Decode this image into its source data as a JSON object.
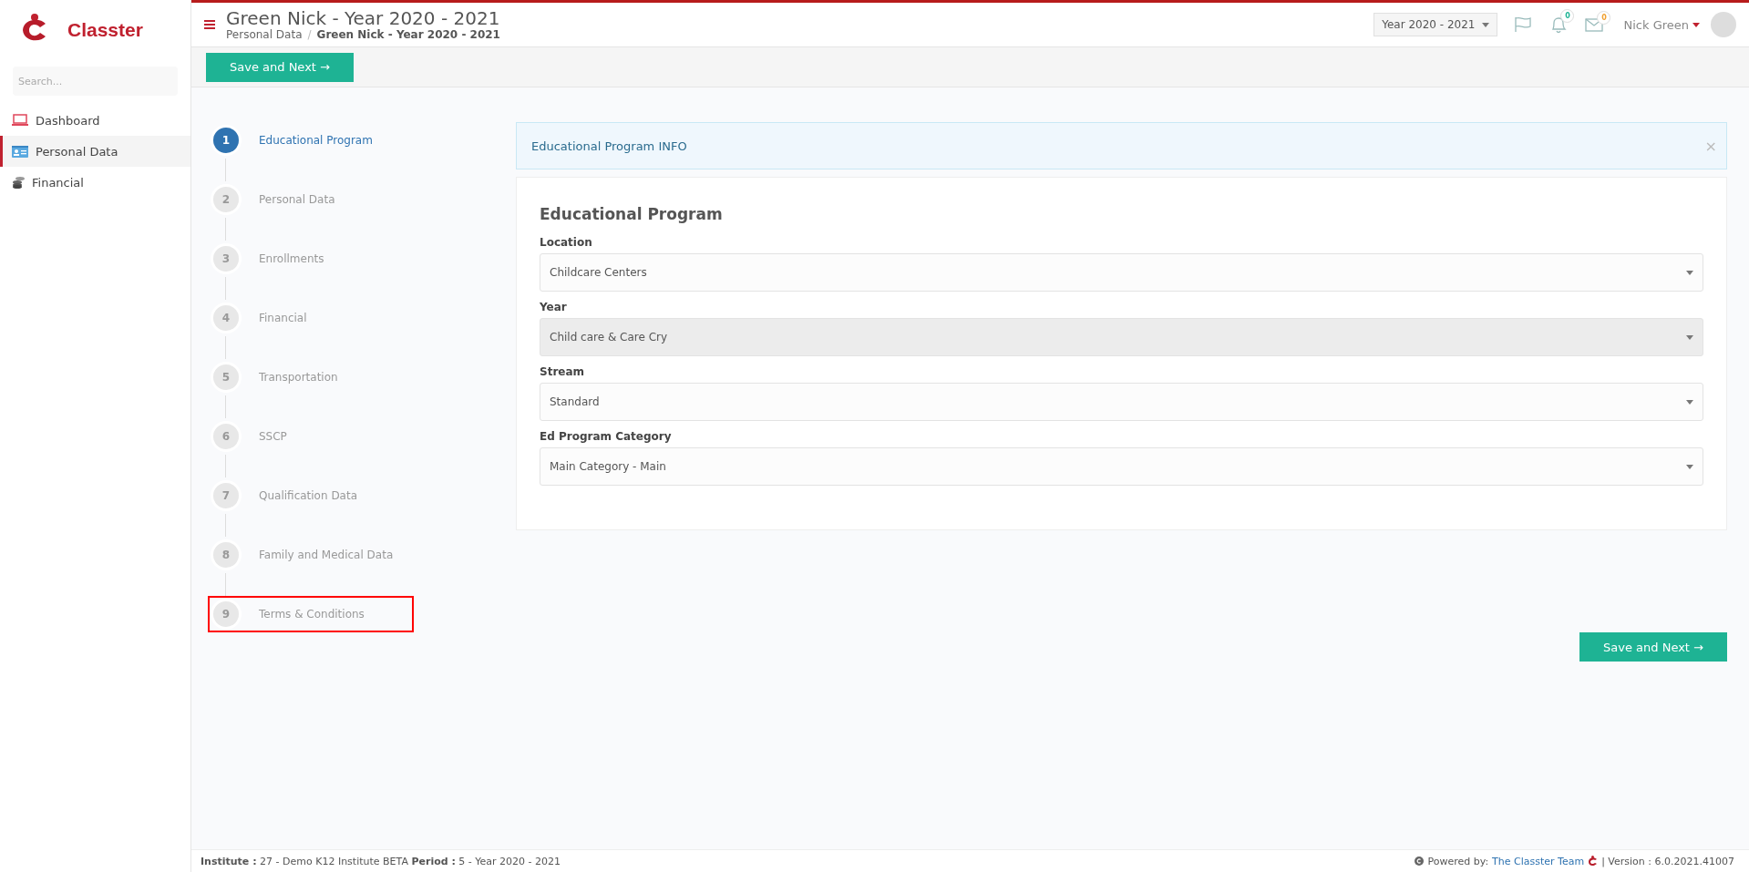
{
  "brand": {
    "name": "Classter"
  },
  "sidebar": {
    "search": {
      "placeholder": "Search..."
    },
    "items": [
      {
        "label": "Dashboard",
        "selected": false
      },
      {
        "label": "Personal Data",
        "selected": true
      },
      {
        "label": "Financial",
        "selected": false
      }
    ]
  },
  "header": {
    "title": "Green Nick - Year 2020 - 2021",
    "breadcrumb": [
      "Personal Data",
      "Green Nick - Year 2020 - 2021"
    ],
    "breadcrumb_separator": "/",
    "year_selector": "Year 2020 - 2021",
    "notifications": "0",
    "messages": "0",
    "user": "Nick Green"
  },
  "toolbar": {
    "button": "Save and Next →"
  },
  "steps": [
    {
      "number": "1",
      "label": "Educational Program",
      "selected": true,
      "highlighted": false
    },
    {
      "number": "2",
      "label": "Personal Data",
      "selected": false,
      "highlighted": false
    },
    {
      "number": "3",
      "label": "Enrollments",
      "selected": false,
      "highlighted": false
    },
    {
      "number": "4",
      "label": "Financial",
      "selected": false,
      "highlighted": false
    },
    {
      "number": "5",
      "label": "Transportation",
      "selected": false,
      "highlighted": false
    },
    {
      "number": "6",
      "label": "SSCP",
      "selected": false,
      "highlighted": false
    },
    {
      "number": "7",
      "label": "Qualification Data",
      "selected": false,
      "highlighted": false
    },
    {
      "number": "8",
      "label": "Family and Medical Data",
      "selected": false,
      "highlighted": false
    },
    {
      "number": "9",
      "label": "Terms & Conditions",
      "selected": false,
      "highlighted": true
    }
  ],
  "info": {
    "text": "Educational Program INFO",
    "close": "×"
  },
  "form": {
    "title": "Educational Program",
    "fields": [
      {
        "label": "Location",
        "value": "Childcare Centers",
        "disabled": false
      },
      {
        "label": "Year",
        "value": "Child care & Care Cry",
        "disabled": true
      },
      {
        "label": "Stream",
        "value": "Standard",
        "disabled": false
      },
      {
        "label": "Ed Program Category",
        "value": "Main Category - Main",
        "disabled": false
      }
    ]
  },
  "bottom_button": "Save and Next →",
  "footer": {
    "info": "**Institute :** 27 - Demo K12 Institute BETA **Period :** 5 - Year 2020 - 2021",
    "powered_by": "Powered by:",
    "team_link": "The Classter Team",
    "version": "| Version : 6.0.2021.41007"
  }
}
